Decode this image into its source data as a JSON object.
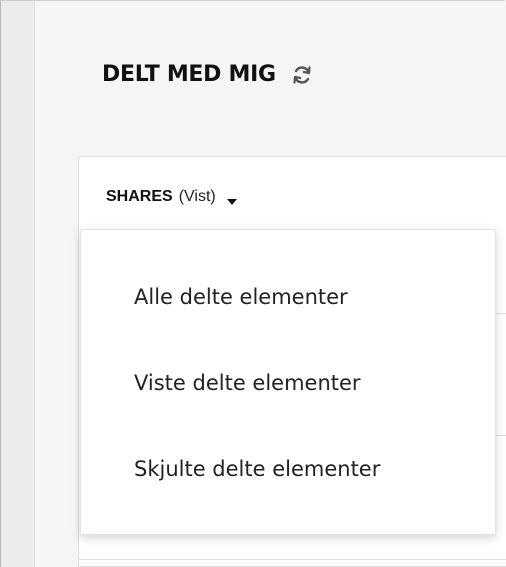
{
  "header": {
    "title": "DELT MED MIG",
    "refresh_icon": "refresh-icon"
  },
  "filter": {
    "label": "SHARES",
    "state": "(Vist)",
    "caret_icon": "caret-down-icon"
  },
  "dropdown": {
    "items": [
      {
        "label": "Alle delte elementer"
      },
      {
        "label": "Viste delte elementer"
      },
      {
        "label": "Skjulte delte elementer"
      }
    ]
  },
  "colors": {
    "background": "#f5f5f5",
    "rail": "#ececec",
    "text": "#111111"
  }
}
